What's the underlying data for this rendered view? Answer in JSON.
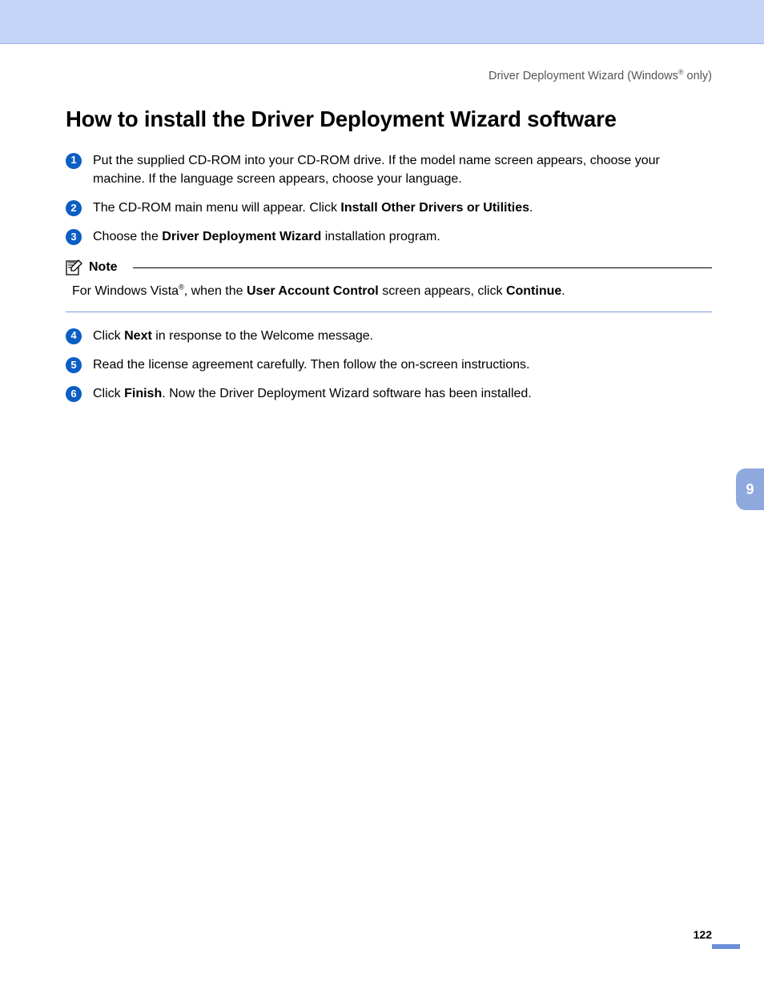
{
  "header": {
    "breadcrumb_pre": "Driver Deployment Wizard (Windows",
    "breadcrumb_post": " only)"
  },
  "title": "How to install the Driver Deployment Wizard software",
  "steps": [
    {
      "n": "1",
      "parts": [
        {
          "t": "Put the supplied CD-ROM into your CD-ROM drive. If the model name screen appears, choose your machine. If the language screen appears, choose your language."
        }
      ]
    },
    {
      "n": "2",
      "parts": [
        {
          "t": "The CD-ROM main menu will appear. Click "
        },
        {
          "t": "Install Other Drivers or Utilities",
          "b": true
        },
        {
          "t": "."
        }
      ]
    },
    {
      "n": "3",
      "parts": [
        {
          "t": "Choose the "
        },
        {
          "t": "Driver Deployment Wizard",
          "b": true
        },
        {
          "t": " installation program."
        }
      ]
    }
  ],
  "note": {
    "label": "Note",
    "body_parts": [
      {
        "t": "For Windows Vista"
      },
      {
        "t": "®",
        "sup": true
      },
      {
        "t": ", when the "
      },
      {
        "t": "User Account Control",
        "b": true
      },
      {
        "t": " screen appears, click "
      },
      {
        "t": "Continue",
        "b": true
      },
      {
        "t": "."
      }
    ]
  },
  "steps2": [
    {
      "n": "4",
      "parts": [
        {
          "t": "Click "
        },
        {
          "t": "Next",
          "b": true
        },
        {
          "t": " in response to the Welcome message."
        }
      ]
    },
    {
      "n": "5",
      "parts": [
        {
          "t": "Read the license agreement carefully. Then follow the on-screen instructions."
        }
      ]
    },
    {
      "n": "6",
      "parts": [
        {
          "t": "Click "
        },
        {
          "t": "Finish",
          "b": true
        },
        {
          "t": ". Now the Driver Deployment Wizard software has been installed."
        }
      ]
    }
  ],
  "section_tab": "9",
  "page_number": "122"
}
